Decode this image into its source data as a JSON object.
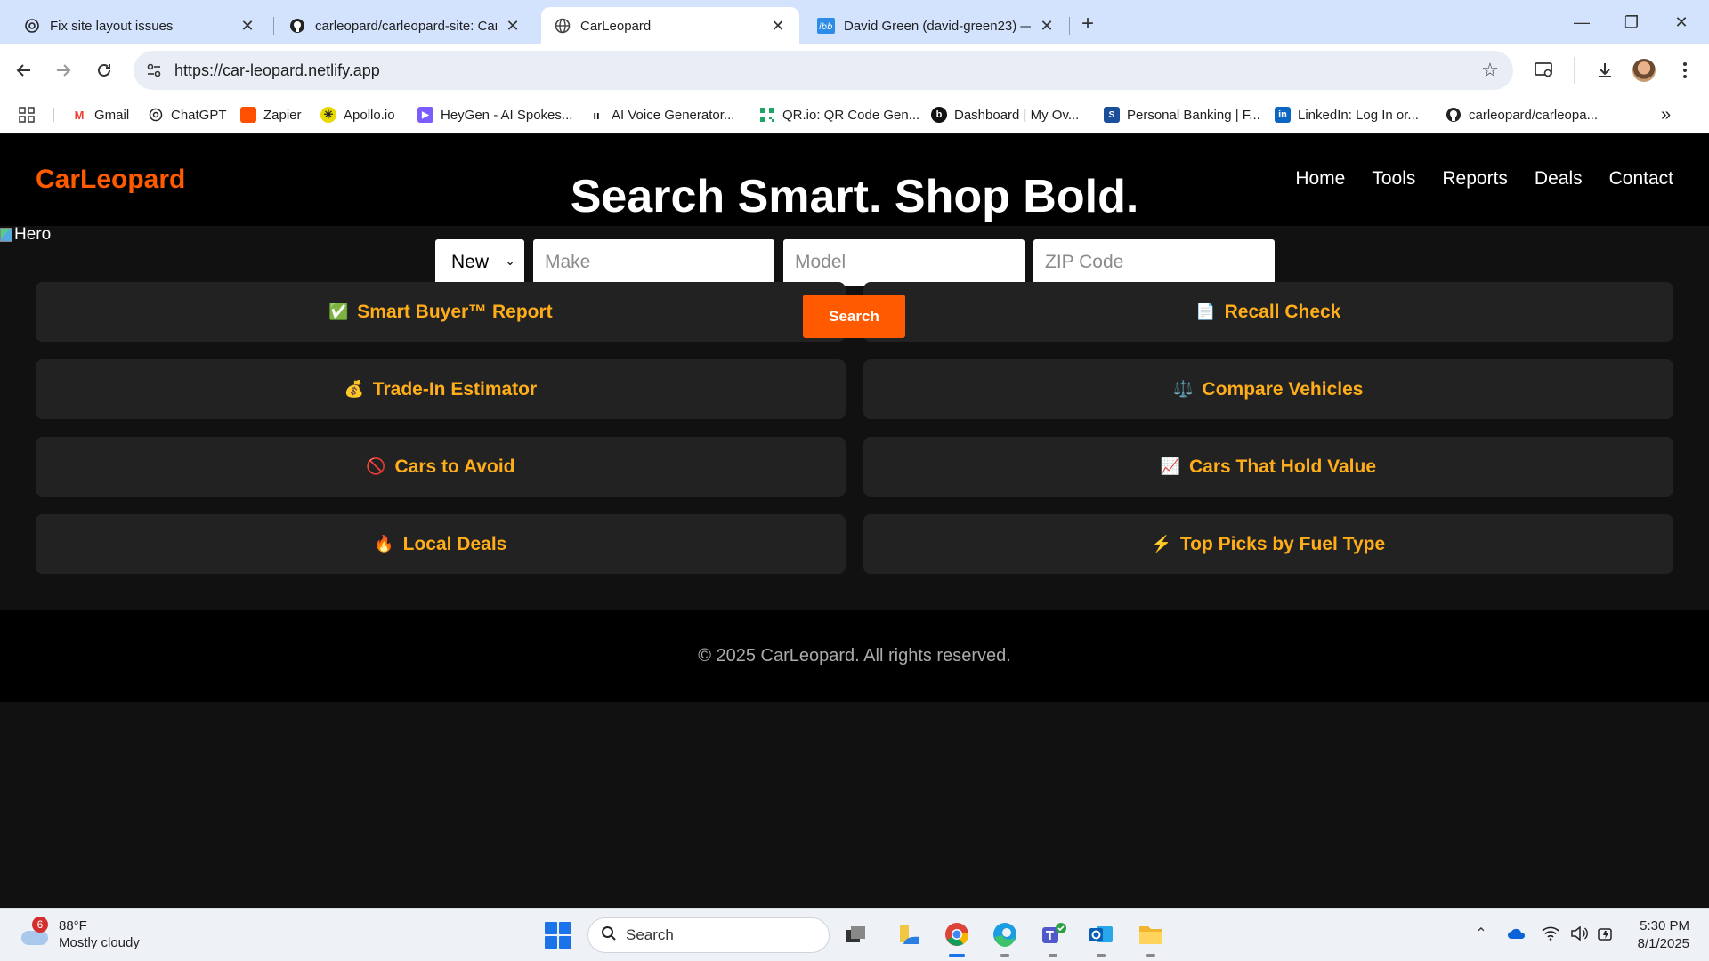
{
  "browser": {
    "tabs": [
      {
        "title": "Fix site layout issues",
        "icon": "openai-icon"
      },
      {
        "title": "carleopard/carleopard-site: Car",
        "icon": "github-icon"
      },
      {
        "title": "CarLeopard",
        "icon": "globe-icon",
        "active": true
      },
      {
        "title": "David Green (david-green23) —",
        "icon": "ibb-icon"
      }
    ],
    "url": "https://car-leopard.netlify.app",
    "bookmarks": [
      {
        "label": "Gmail",
        "icon": "gmail-icon",
        "color": "#ea4335"
      },
      {
        "label": "ChatGPT",
        "icon": "openai-icon",
        "color": "#222222"
      },
      {
        "label": "Zapier",
        "icon": "zapier-icon",
        "color": "#ff4f00"
      },
      {
        "label": "Apollo.io",
        "icon": "apollo-icon",
        "color": "#e8d900"
      },
      {
        "label": "HeyGen - AI Spokes...",
        "icon": "heygen-icon",
        "color": "#7b5cff"
      },
      {
        "label": "AI Voice Generator...",
        "icon": "elevenlabs-icon",
        "color": "#111111"
      },
      {
        "label": "QR.io: QR Code Gen...",
        "icon": "qr-icon",
        "color": "#1fa463"
      },
      {
        "label": "Dashboard | My Ov...",
        "icon": "dashboard-icon",
        "color": "#111111"
      },
      {
        "label": "Personal Banking | F...",
        "icon": "bank-icon",
        "color": "#1b4f9c"
      },
      {
        "label": "LinkedIn: Log In or...",
        "icon": "linkedin-icon",
        "color": "#0a66c2"
      },
      {
        "label": "carleopard/carleopa...",
        "icon": "github-icon",
        "color": "#111111"
      }
    ]
  },
  "site": {
    "logo": "CarLeopard",
    "hero_title": "Search Smart. Shop Bold.",
    "nav": [
      "Home",
      "Tools",
      "Reports",
      "Deals",
      "Contact"
    ],
    "hero_alt": "Hero",
    "search": {
      "condition": "New",
      "make_placeholder": "Make",
      "model_placeholder": "Model",
      "zip_placeholder": "ZIP Code",
      "button": "Search"
    },
    "cards": [
      {
        "label": "Smart Buyer™ Report",
        "emoji": "✅"
      },
      {
        "label": "Recall Check",
        "emoji": "📄"
      },
      {
        "label": "Trade-In Estimator",
        "emoji": "💰"
      },
      {
        "label": "Compare Vehicles",
        "emoji": "⚖️"
      },
      {
        "label": "Cars to Avoid",
        "emoji": "🚫"
      },
      {
        "label": "Cars That Hold Value",
        "emoji": "📈"
      },
      {
        "label": "Local Deals",
        "emoji": "🔥"
      },
      {
        "label": "Top Picks by Fuel Type",
        "emoji": "⚡"
      }
    ],
    "footer": "© 2025 CarLeopard. All rights reserved.",
    "accent_color": "#ff5a00",
    "card_text_color": "#ffae1a"
  },
  "taskbar": {
    "weather_temp": "88°F",
    "weather_desc": "Mostly cloudy",
    "weather_badge": "6",
    "search_label": "Search",
    "time": "5:30 PM",
    "date": "8/1/2025"
  }
}
